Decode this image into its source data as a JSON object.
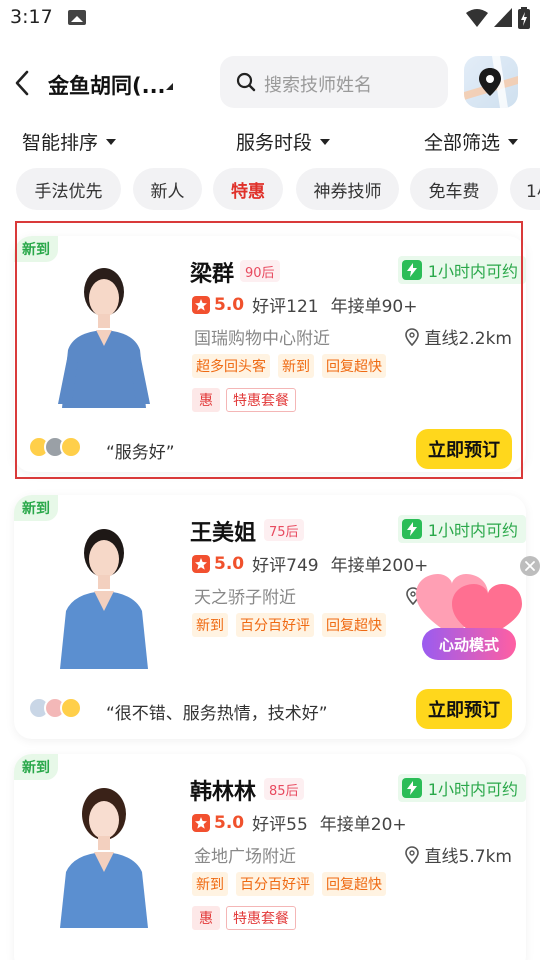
{
  "status_bar": {
    "time": "3:17"
  },
  "header": {
    "location": "金鱼胡同(...",
    "search_placeholder": "搜索技师姓名"
  },
  "filters": [
    {
      "label": "智能排序"
    },
    {
      "label": "服务时段"
    },
    {
      "label": "全部筛选"
    }
  ],
  "tags": [
    {
      "label": "手法优先"
    },
    {
      "label": "新人"
    },
    {
      "label": "特惠"
    },
    {
      "label": "神券技师"
    },
    {
      "label": "免车费"
    },
    {
      "label": "1小"
    }
  ],
  "therapists": [
    {
      "new_badge": "新到",
      "name": "梁群",
      "age": "90后",
      "availability": "1小时内可约",
      "rating": "5.0",
      "reviews": "好评121",
      "orders": "年接单90+",
      "address": "国瑞购物中心附近",
      "distance": "直线2.2km",
      "features": [
        "超多回头客",
        "新到",
        "回复超快"
      ],
      "promo_badge": "惠",
      "promo_label": "特惠套餐",
      "review_quote": "“服务好”",
      "book_label": "立即预订"
    },
    {
      "new_badge": "新到",
      "name": "王美姐",
      "age": "75后",
      "availability": "1小时内可约",
      "rating": "5.0",
      "reviews": "好评749",
      "orders": "年接单200+",
      "address": "天之骄子附近",
      "distance": "直线",
      "features": [
        "新到",
        "百分百好评",
        "回复超快"
      ],
      "review_quote": "“很不错、服务热情，技术好”",
      "book_label": "立即预订"
    },
    {
      "new_badge": "新到",
      "name": "韩林林",
      "age": "85后",
      "availability": "1小时内可约",
      "rating": "5.0",
      "reviews": "好评55",
      "orders": "年接单20+",
      "address": "金地广场附近",
      "distance": "直线5.7km",
      "features": [
        "新到",
        "百分百好评",
        "回复超快"
      ],
      "promo_badge": "惠",
      "promo_label": "特惠套餐"
    }
  ],
  "float_promo": {
    "label": "心动模式"
  },
  "colors": {
    "accent_red": "#e0312a",
    "book_yellow": "#ffd71c",
    "green": "#2aa84a",
    "orange": "#ef6a13"
  }
}
